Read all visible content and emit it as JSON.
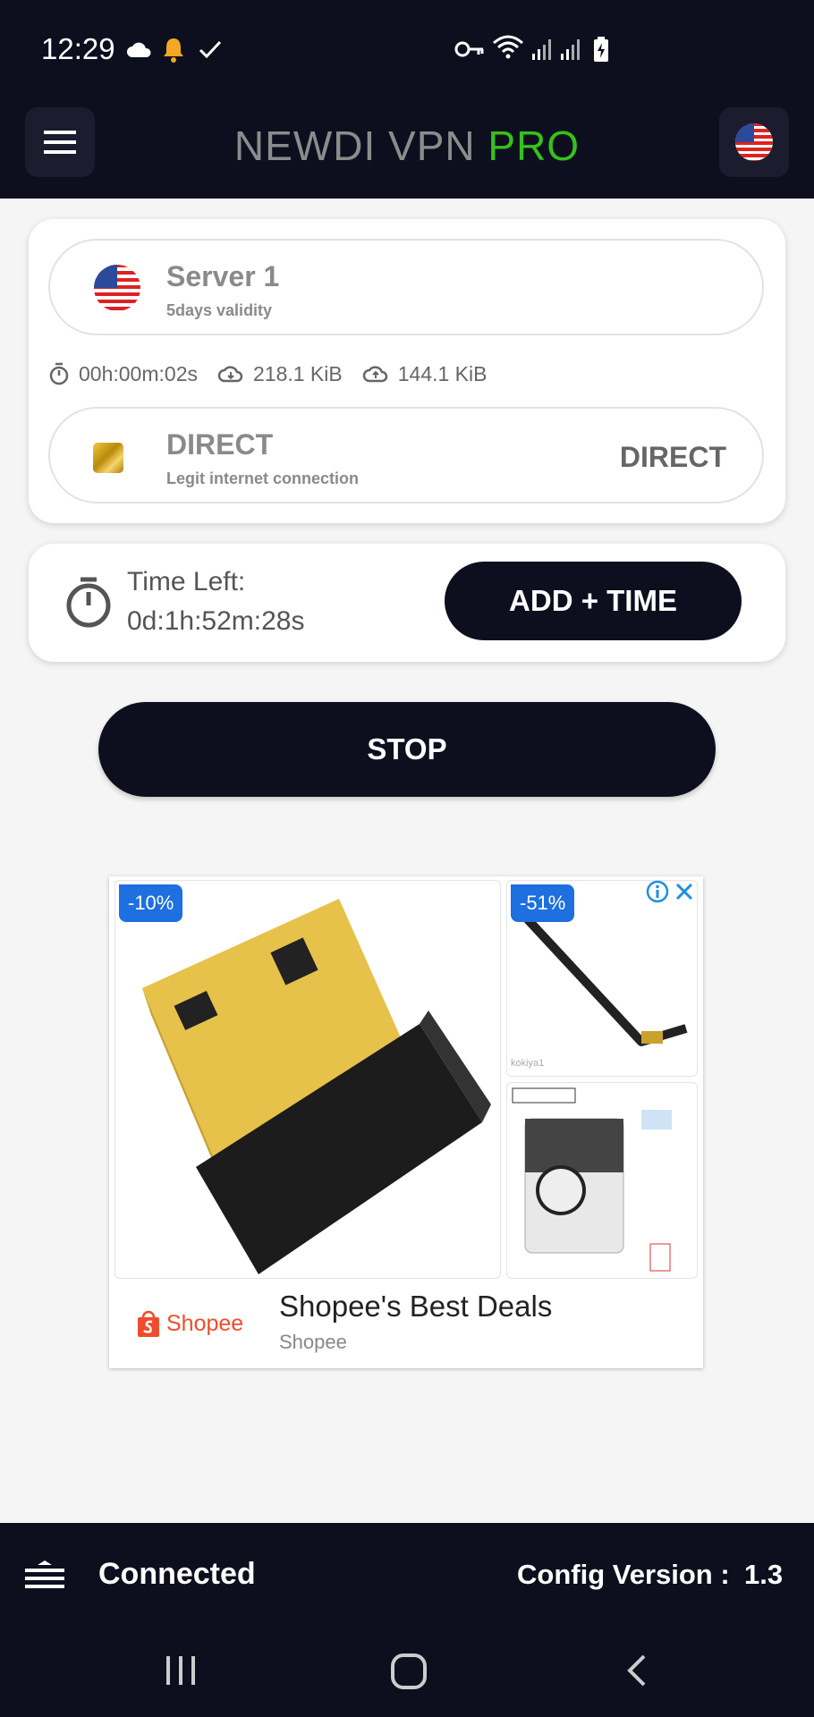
{
  "status_bar": {
    "time": "12:29"
  },
  "app_bar": {
    "title_part1": "NEWDI VPN ",
    "title_part2": "PRO"
  },
  "server": {
    "name": "Server 1",
    "validity": "5days validity",
    "flag_icon": "us-flag-icon"
  },
  "stats": {
    "duration": "00h:00m:02s",
    "download": "218.1 KiB",
    "upload": "144.1 KiB"
  },
  "connection": {
    "title": "DIRECT",
    "subtitle": "Legit internet connection",
    "mode": "DIRECT"
  },
  "time_left": {
    "label": "Time Left:",
    "value": "0d:1h:52m:28s",
    "add_button": "ADD + TIME"
  },
  "stop_button": "STOP",
  "ad": {
    "badge_main": "-10%",
    "badge_side": "-51%",
    "seller_caption": "kokiya1",
    "title": "Shopee's Best Deals",
    "advertiser": "Shopee",
    "logo_text": "Shopee"
  },
  "bottom_bar": {
    "status": "Connected",
    "config_label": "Config Version :",
    "config_value": "1.3"
  },
  "colors": {
    "dark": "#0d0f1f",
    "accent_green": "#35c21a",
    "shopee_orange": "#ee4d2d",
    "badge_blue": "#1e6fe0"
  }
}
